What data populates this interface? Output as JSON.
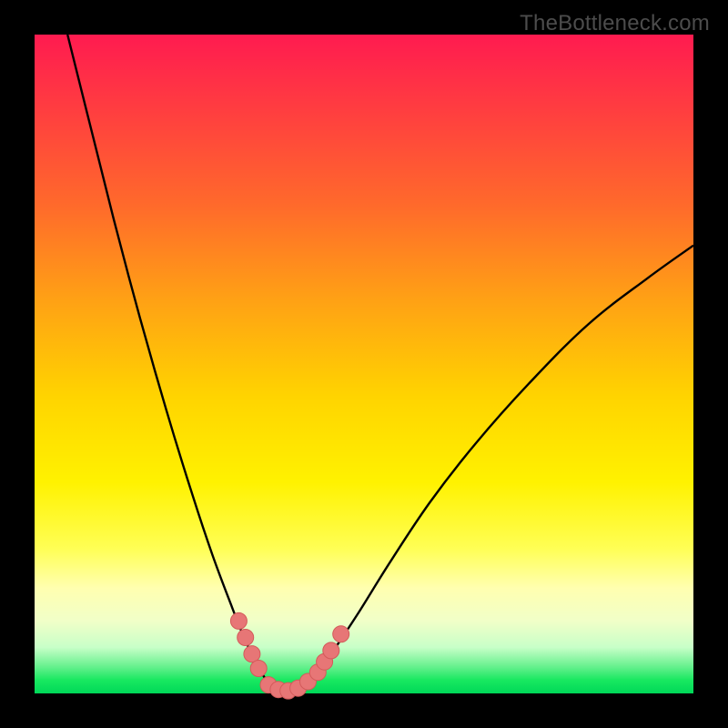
{
  "watermark": "TheBottleneck.com",
  "chart_data": {
    "type": "line",
    "title": "",
    "xlabel": "",
    "ylabel": "",
    "xlim": [
      0,
      100
    ],
    "ylim": [
      0,
      100
    ],
    "series": [
      {
        "name": "left-curve",
        "x": [
          5,
          8,
          12,
          16,
          20,
          24,
          27,
          30,
          32,
          34,
          35.5,
          37
        ],
        "y": [
          100,
          88,
          72,
          57,
          43,
          30,
          21,
          13,
          8,
          4,
          1.5,
          0
        ]
      },
      {
        "name": "right-curve",
        "x": [
          40,
          42,
          45,
          49,
          54,
          60,
          67,
          75,
          84,
          93,
          100
        ],
        "y": [
          0,
          2,
          6,
          12,
          20,
          29,
          38,
          47,
          56,
          63,
          68
        ]
      }
    ],
    "markers": [
      {
        "name": "left-marker-1",
        "x": 31,
        "y": 11
      },
      {
        "name": "left-marker-2",
        "x": 32,
        "y": 8.5
      },
      {
        "name": "left-marker-3",
        "x": 33,
        "y": 6
      },
      {
        "name": "left-marker-4",
        "x": 34,
        "y": 3.8
      },
      {
        "name": "bottom-marker-1",
        "x": 35.5,
        "y": 1.3
      },
      {
        "name": "bottom-marker-2",
        "x": 37,
        "y": 0.6
      },
      {
        "name": "bottom-marker-3",
        "x": 38.5,
        "y": 0.4
      },
      {
        "name": "bottom-marker-4",
        "x": 40,
        "y": 0.8
      },
      {
        "name": "right-marker-1",
        "x": 41.5,
        "y": 1.8
      },
      {
        "name": "right-marker-2",
        "x": 43,
        "y": 3.2
      },
      {
        "name": "right-marker-3",
        "x": 44,
        "y": 4.8
      },
      {
        "name": "right-marker-4",
        "x": 45,
        "y": 6.5
      },
      {
        "name": "right-marker-5",
        "x": 46.5,
        "y": 9
      }
    ],
    "colors": {
      "curve": "#000000",
      "marker_fill": "#e77676",
      "marker_stroke": "#d35a5a"
    }
  }
}
